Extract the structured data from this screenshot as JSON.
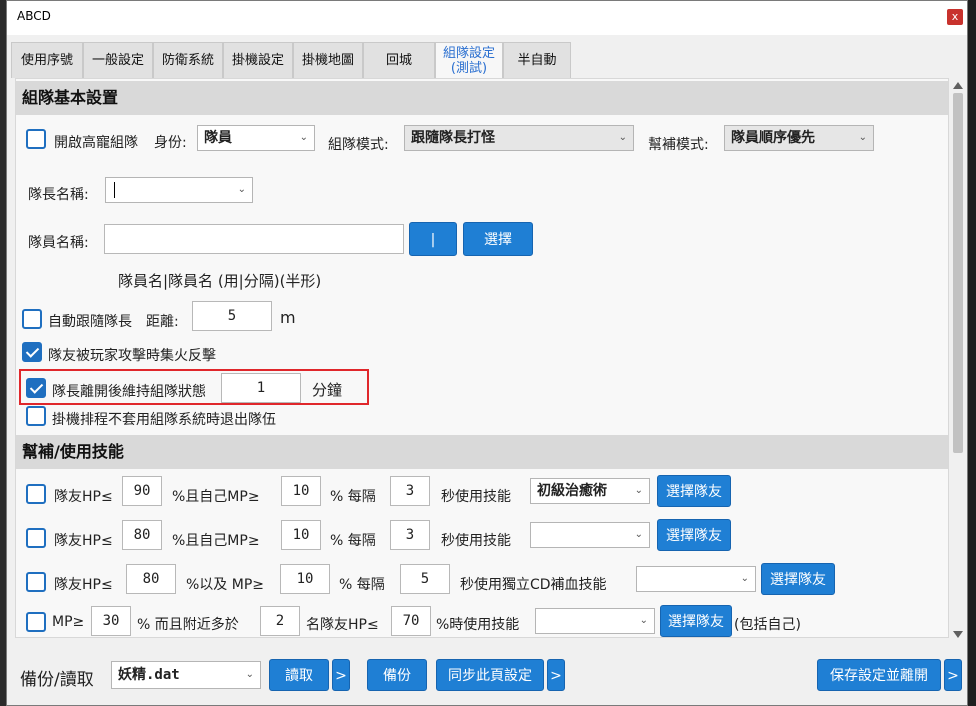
{
  "window": {
    "title": "ABCD",
    "close_label": "x"
  },
  "tabs": [
    "使用序號",
    "一般設定",
    "防衛系統",
    "掛機設定",
    "掛機地圖",
    "回城",
    "組隊設定\n(測試)",
    "半自動"
  ],
  "section1": {
    "title": "組隊基本設置",
    "enable_party_label": "開啟高寵組隊",
    "role_label": "身份:",
    "role_value": "隊員",
    "mode_label": "組隊模式:",
    "mode_value": "跟隨隊長打怪",
    "heal_mode_label": "幫補模式:",
    "heal_mode_value": "隊員順序優先",
    "leader_name_label": "隊長名稱:",
    "leader_name_value": "",
    "member_name_label": "隊員名稱:",
    "member_name_value": "",
    "separator_button": "|",
    "select_button": "選擇",
    "member_hint": "隊員名|隊員名 (用|分隔)(半形)",
    "auto_follow_label": "自動跟隨隊長",
    "distance_label": "距離:",
    "distance_value": "5",
    "distance_unit": "m",
    "counter_attack_label": "隊友被玩家攻擊時集火反擊",
    "keep_party_label": "隊長離開後維持組隊狀態",
    "keep_party_value": "1",
    "keep_party_unit": "分鐘",
    "exit_party_label": "掛機排程不套用組隊系統時退出隊伍"
  },
  "section2": {
    "title": "幫補/使用技能",
    "rows": [
      {
        "a": "隊友HP≤",
        "hp": "90",
        "b": "%且自己MP≥",
        "mp": "10",
        "c": "% 每隔",
        "sec": "3",
        "d": "秒使用技能",
        "skill": "初級治癒術",
        "btn": "選擇隊友"
      },
      {
        "a": "隊友HP≤",
        "hp": "80",
        "b": "%且自己MP≥",
        "mp": "10",
        "c": "% 每隔",
        "sec": "3",
        "d": "秒使用技能",
        "skill": "",
        "btn": "選擇隊友"
      },
      {
        "a": "隊友HP≤",
        "hp": "80",
        "b": "%以及 MP≥",
        "mp": "10",
        "c": "% 每隔",
        "sec": "5",
        "d": "秒使用獨立CD補血技能",
        "skill": "",
        "btn": "選擇隊友"
      }
    ],
    "row4": {
      "a": "MP≥",
      "mp": "30",
      "b": "% 而且附近多於",
      "n": "2",
      "c": "名隊友HP≤",
      "hp": "70",
      "d": "%時使用技能",
      "skill": "",
      "btn": "選擇隊友",
      "e": "(包括自己)"
    }
  },
  "footer": {
    "backup_label": "備份/讀取",
    "file_value": "妖精.dat",
    "read_button": "讀取",
    "more_1": ">",
    "backup_button": "備份",
    "sync_button": "同步此頁設定",
    "more_2": ">",
    "save_button": "保存設定並離開",
    "more_3": ">"
  },
  "colors": {
    "accent": "#1f7fd4",
    "highlight_box": "#e0272b",
    "checkbox": "#1f6fc0"
  }
}
